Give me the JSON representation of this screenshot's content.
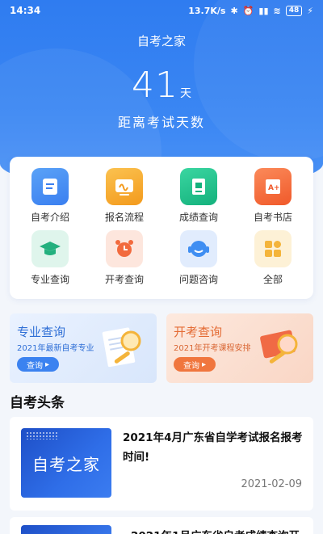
{
  "status_bar": {
    "time": "14:34",
    "net_speed": "13.7K/s",
    "battery": "48"
  },
  "header": {
    "title": "自考之家",
    "days_number": "41",
    "days_unit": "天",
    "countdown_label": "距离考试天数"
  },
  "grid": [
    {
      "label": "自考介绍",
      "icon": "document-icon",
      "color": "#3f8ef2"
    },
    {
      "label": "报名流程",
      "icon": "signature-icon",
      "color": "#f6a323"
    },
    {
      "label": "成绩查询",
      "icon": "book-icon",
      "color": "#21c18c"
    },
    {
      "label": "自考书店",
      "icon": "grade-book-icon",
      "color": "#f46a3c"
    },
    {
      "label": "专业查询",
      "icon": "graduation-cap-icon",
      "color": "#23b07e"
    },
    {
      "label": "开考查询",
      "icon": "alarm-clock-icon",
      "color": "#f26a3d"
    },
    {
      "label": "问题咨询",
      "icon": "headset-icon",
      "color": "#3f8ef2"
    },
    {
      "label": "全部",
      "icon": "all-apps-icon",
      "color": "#f4b43a"
    }
  ],
  "banners": [
    {
      "title": "专业查询",
      "subtitle": "2021年最新自考专业",
      "button": "查询"
    },
    {
      "title": "开考查询",
      "subtitle": "2021年开考课程安排",
      "button": "查询"
    }
  ],
  "news_section": {
    "title": "自考头条",
    "items": [
      {
        "thumb_text": "自考之家",
        "title": "2021年4月广东省自学考试报名报考时间!",
        "date": "2021-02-09"
      },
      {
        "title": "2021年1月广东省自考成绩查询开"
      }
    ]
  },
  "colors": {
    "primary": "#2f7cf0",
    "accent_orange": "#f0763e"
  }
}
